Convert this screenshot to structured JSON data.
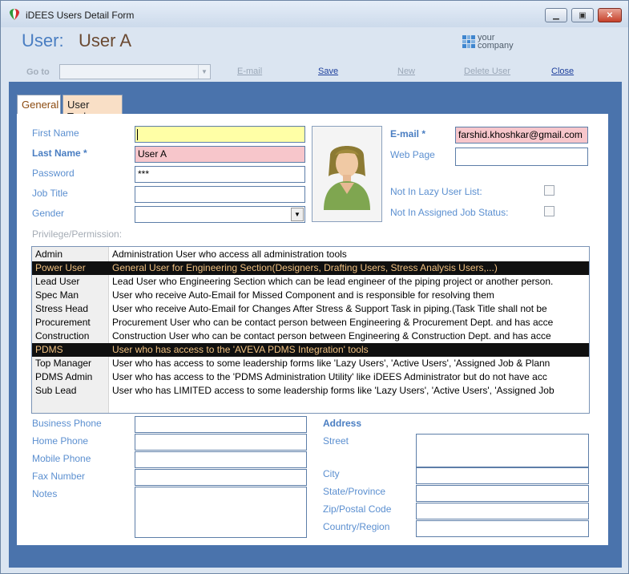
{
  "window": {
    "title": "iDEES Users Detail Form",
    "minimize": "▁",
    "restore": "▣",
    "close": "✕"
  },
  "header": {
    "user_label": "User:",
    "user_name": "User A",
    "logo_line1": "your",
    "logo_line2": "company"
  },
  "toolbar": {
    "goto_label": "Go to",
    "goto_value": "",
    "email": "E-mail",
    "save": "Save",
    "new": "New",
    "delete_user": "Delete User",
    "close": "Close"
  },
  "tabs": [
    {
      "label": "General"
    },
    {
      "label": "User Tasks"
    }
  ],
  "form": {
    "first_name_label": "First Name",
    "first_name": "",
    "last_name_label": "Last Name *",
    "last_name": "User A",
    "password_label": "Password",
    "password": "***",
    "job_title_label": "Job Title",
    "job_title": "",
    "gender_label": "Gender",
    "gender": "",
    "email_label": "E-mail  *",
    "email": "farshid.khoshkar@gmail.com",
    "web_page_label": "Web Page",
    "web_page": "",
    "lazy_label": "Not In Lazy User List:",
    "assigned_label": "Not In Assigned Job Status:",
    "privilege_label": "Privilege/Permission:"
  },
  "privileges": [
    {
      "role": "Admin",
      "desc": "Administration User who access all administration tools",
      "selected": false
    },
    {
      "role": "Power User",
      "desc": "General User for Engineering Section(Designers, Drafting Users, Stress Analysis Users,...)",
      "selected": true
    },
    {
      "role": "Lead User",
      "desc": "Lead User who Engineering Section which can be lead engineer of the piping project or another person.",
      "selected": false
    },
    {
      "role": "Spec Man",
      "desc": "User who receive Auto-Email for Missed Component and is responsible for resolving them",
      "selected": false
    },
    {
      "role": "Stress Head",
      "desc": "User who receive Auto-Email for Changes After Stress & Support Task in piping.(Task Title shall not be",
      "selected": false
    },
    {
      "role": "Procurement",
      "desc": "Procurement User who can be contact person between Engineering & Procurement Dept. and has acce",
      "selected": false
    },
    {
      "role": "Construction",
      "desc": "Construction User who can be contact person between Engineering & Construction Dept. and has acce",
      "selected": false
    },
    {
      "role": "PDMS",
      "desc": "User who has access to the 'AVEVA PDMS Integration' tools",
      "selected": true
    },
    {
      "role": "Top Manager",
      "desc": "User who has access to some leadership forms like 'Lazy Users', 'Active Users', 'Assigned Job & Plann",
      "selected": false
    },
    {
      "role": "PDMS Admin",
      "desc": "User who has access to the 'PDMS Administration Utility' like iDEES Administrator but do not have acc",
      "selected": false
    },
    {
      "role": "Sub Lead",
      "desc": "User who has LIMITED access to some leadership forms like 'Lazy Users', 'Active Users', 'Assigned Job",
      "selected": false
    }
  ],
  "contact": {
    "business_phone_label": "Business Phone",
    "business_phone": "",
    "home_phone_label": "Home Phone",
    "home_phone": "",
    "mobile_phone_label": "Mobile Phone",
    "mobile_phone": "",
    "fax_label": "Fax Number",
    "fax": "",
    "notes_label": "Notes",
    "notes": ""
  },
  "address": {
    "heading": "Address",
    "street_label": "Street",
    "street": "",
    "city_label": "City",
    "city": "",
    "state_label": "State/Province",
    "state": "",
    "zip_label": "Zip/Postal Code",
    "zip": "",
    "country_label": "Country/Region",
    "country": ""
  },
  "colors": {
    "accent": "#4a7ec2",
    "frame_blue": "#4a73ac",
    "required_pink": "#f7c6cb",
    "focus_yellow": "#ffffa6",
    "tab_active_text": "#8b4a0f"
  },
  "icons": {
    "app": "italy-flag-icon",
    "photo": "user-portrait-icon",
    "logo": "company-logo-icon"
  }
}
